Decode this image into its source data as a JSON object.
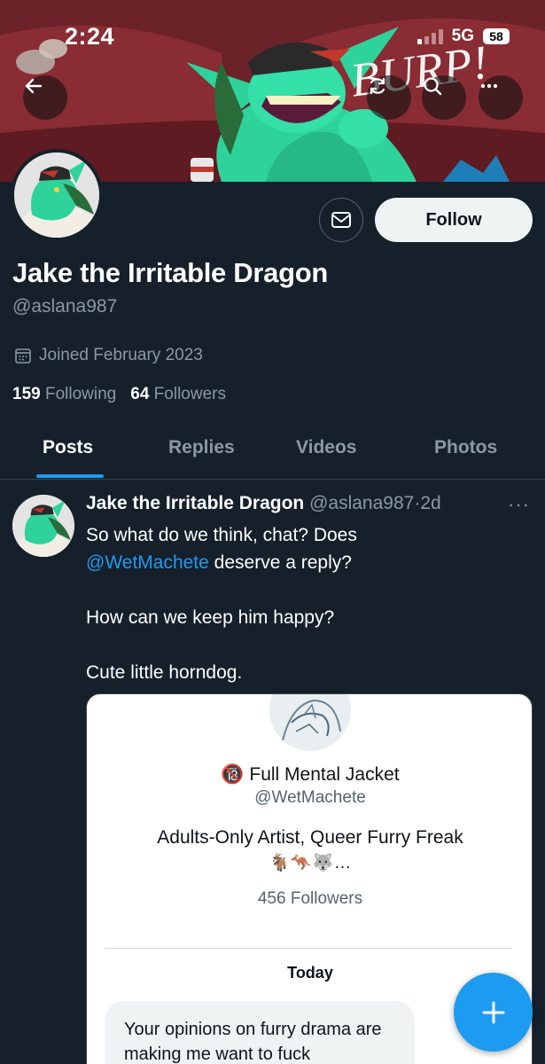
{
  "status_bar": {
    "time": "2:24",
    "network": "5G",
    "battery": "58"
  },
  "banner": {
    "sound_text": "BURP!"
  },
  "profile": {
    "message_icon": "envelope-icon",
    "follow_label": "Follow",
    "display_name": "Jake the Irritable Dragon",
    "handle": "@aslana987",
    "joined": "Joined February 2023",
    "following_count": "159",
    "following_label": "Following",
    "followers_count": "64",
    "followers_label": "Followers"
  },
  "tabs": [
    {
      "label": "Posts",
      "active": true
    },
    {
      "label": "Replies",
      "active": false
    },
    {
      "label": "Videos",
      "active": false
    },
    {
      "label": "Photos",
      "active": false
    }
  ],
  "post": {
    "author": "Jake the Irritable Dragon",
    "handle": "@aslana987",
    "separator": "·",
    "age": "2d",
    "more": "···",
    "line1": "So what do we think, chat? Does",
    "mention": "@WetMachete",
    "line2_rest": " deserve a reply?",
    "para2": "How can we keep him happy?",
    "para3": "Cute little horndog.",
    "embed": {
      "badge": "🔞",
      "name": "Full Mental Jacket",
      "handle": "@WetMachete",
      "bio": "Adults-Only Artist, Queer Furry Freak",
      "emojis": "🐐🦘🐺...",
      "followers": "456 Followers",
      "day": "Today",
      "message": "Your opinions on furry drama are making me want to fuck"
    }
  },
  "colors": {
    "background": "#15202b",
    "accent": "#1d9bf0",
    "muted": "#8b98a5",
    "divider": "#38444d"
  }
}
